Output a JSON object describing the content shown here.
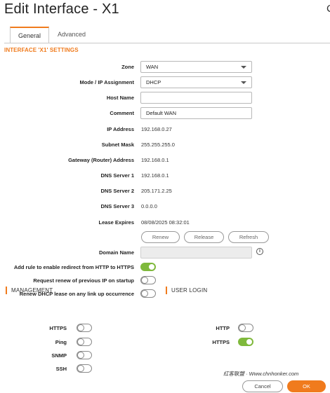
{
  "title": "Edit Interface - X1",
  "edge_char": "C",
  "tabs": [
    {
      "label": "General",
      "active": true
    },
    {
      "label": "Advanced",
      "active": false
    }
  ],
  "section_title": "INTERFACE 'X1' SETTINGS",
  "fields": {
    "zone": {
      "label": "Zone",
      "value": "WAN"
    },
    "mode": {
      "label": "Mode / IP Assignment",
      "value": "DHCP"
    },
    "host_name": {
      "label": "Host Name",
      "value": ""
    },
    "comment": {
      "label": "Comment",
      "value": "Default WAN"
    },
    "ip_address": {
      "label": "IP Address",
      "value": "192.168.0.27"
    },
    "subnet_mask": {
      "label": "Subnet Mask",
      "value": "255.255.255.0"
    },
    "gateway": {
      "label": "Gateway (Router) Address",
      "value": "192.168.0.1"
    },
    "dns1": {
      "label": "DNS Server 1",
      "value": "192.168.0.1"
    },
    "dns2": {
      "label": "DNS Server 2",
      "value": "205.171.2.25"
    },
    "dns3": {
      "label": "DNS Server 3",
      "value": "0.0.0.0"
    },
    "lease": {
      "label": "Lease Expires",
      "value": "08/08/2025 08:32:01"
    },
    "domain_name": {
      "label": "Domain Name",
      "value": ""
    }
  },
  "lease_buttons": {
    "renew": "Renew",
    "release": "Release",
    "refresh": "Refresh"
  },
  "options": {
    "redirect": {
      "label": "Add rule to enable redirect from HTTP to HTTPS",
      "on": true
    },
    "request_renew": {
      "label": "Request renew of previous IP on startup",
      "on": false
    },
    "renew_link": {
      "label": "Renew DHCP lease on any link up occurrence",
      "on": false
    }
  },
  "management": {
    "title": "MANAGEMENT",
    "items": [
      {
        "label": "HTTPS",
        "on": false
      },
      {
        "label": "Ping",
        "on": false
      },
      {
        "label": "SNMP",
        "on": false
      },
      {
        "label": "SSH",
        "on": false
      }
    ]
  },
  "user_login": {
    "title": "USER LOGIN",
    "items": [
      {
        "label": "HTTP",
        "on": false
      },
      {
        "label": "HTTPS",
        "on": true
      }
    ]
  },
  "watermark": "红客联盟 · Www.chnhonker.com",
  "footer": {
    "cancel": "Cancel",
    "ok": "OK"
  },
  "colors": {
    "accent": "#f07b1d",
    "toggle_on": "#7fb93c"
  }
}
